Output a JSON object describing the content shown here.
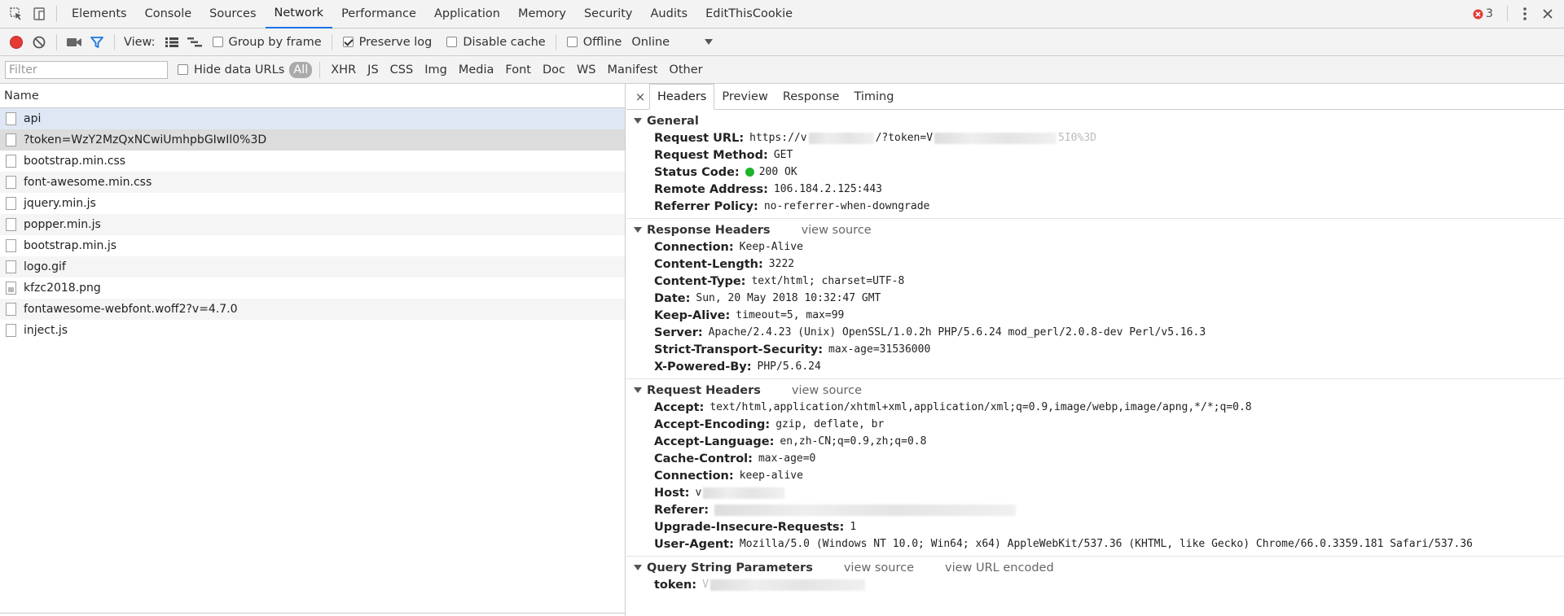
{
  "top": {
    "tabs": [
      "Elements",
      "Console",
      "Sources",
      "Network",
      "Performance",
      "Application",
      "Memory",
      "Security",
      "Audits",
      "EditThisCookie"
    ],
    "active_tab": "Network",
    "error_count": "3",
    "colors": {
      "error": "#e53935",
      "accent": "#1a73e8"
    }
  },
  "toolbar": {
    "view_label": "View:",
    "group_by_frame": "Group by frame",
    "preserve_log": "Preserve log",
    "disable_cache": "Disable cache",
    "offline": "Offline",
    "throttle": "Online",
    "record_color": "#e53935",
    "filter_icon_color": "#1a73e8"
  },
  "filterbar": {
    "filter_placeholder": "Filter",
    "hide_data_urls": "Hide data URLs",
    "types": [
      "All",
      "XHR",
      "JS",
      "CSS",
      "Img",
      "Media",
      "Font",
      "Doc",
      "WS",
      "Manifest",
      "Other"
    ],
    "selected_type": "All"
  },
  "requests": {
    "header": "Name",
    "items": [
      {
        "name": "api",
        "icon": "doc"
      },
      {
        "name": "?token=WzY2MzQxNCwiUmhpbGIwIl0%3D",
        "icon": "doc"
      },
      {
        "name": "bootstrap.min.css",
        "icon": "doc"
      },
      {
        "name": "font-awesome.min.css",
        "icon": "doc"
      },
      {
        "name": "jquery.min.js",
        "icon": "doc"
      },
      {
        "name": "popper.min.js",
        "icon": "doc"
      },
      {
        "name": "bootstrap.min.js",
        "icon": "doc"
      },
      {
        "name": "logo.gif",
        "icon": "doc"
      },
      {
        "name": "kfzc2018.png",
        "icon": "img"
      },
      {
        "name": "fontawesome-webfont.woff2?v=4.7.0",
        "icon": "doc"
      },
      {
        "name": "inject.js",
        "icon": "doc"
      }
    ]
  },
  "details": {
    "close": "×",
    "tabs": [
      "Headers",
      "Preview",
      "Response",
      "Timing"
    ],
    "active_tab": "Headers",
    "general": {
      "title": "General",
      "request_url_key": "Request URL:",
      "request_url_prefix": "https://v",
      "request_url_mid": "/?token=V",
      "request_url_tail": "5I0%3D",
      "method_key": "Request Method:",
      "method": "GET",
      "status_key": "Status Code:",
      "status": "200 OK",
      "remote_key": "Remote Address:",
      "remote": "106.184.2.125:443",
      "referrer_policy_key": "Referrer Policy:",
      "referrer_policy": "no-referrer-when-downgrade"
    },
    "response_headers": {
      "title": "Response Headers",
      "view_source": "view source",
      "items": [
        {
          "k": "Connection:",
          "v": "Keep-Alive"
        },
        {
          "k": "Content-Length:",
          "v": "3222"
        },
        {
          "k": "Content-Type:",
          "v": "text/html; charset=UTF-8"
        },
        {
          "k": "Date:",
          "v": "Sun, 20 May 2018 10:32:47 GMT"
        },
        {
          "k": "Keep-Alive:",
          "v": "timeout=5, max=99"
        },
        {
          "k": "Server:",
          "v": "Apache/2.4.23 (Unix) OpenSSL/1.0.2h PHP/5.6.24 mod_perl/2.0.8-dev Perl/v5.16.3"
        },
        {
          "k": "Strict-Transport-Security:",
          "v": "max-age=31536000"
        },
        {
          "k": "X-Powered-By:",
          "v": "PHP/5.6.24"
        }
      ]
    },
    "request_headers": {
      "title": "Request Headers",
      "view_source": "view source",
      "items": [
        {
          "k": "Accept:",
          "v": "text/html,application/xhtml+xml,application/xml;q=0.9,image/webp,image/apng,*/*;q=0.8"
        },
        {
          "k": "Accept-Encoding:",
          "v": "gzip, deflate, br"
        },
        {
          "k": "Accept-Language:",
          "v": "en,zh-CN;q=0.9,zh;q=0.8"
        },
        {
          "k": "Cache-Control:",
          "v": "max-age=0"
        },
        {
          "k": "Connection:",
          "v": "keep-alive"
        },
        {
          "k": "Host:",
          "v": "v"
        },
        {
          "k": "Referer:",
          "v": ""
        },
        {
          "k": "Upgrade-Insecure-Requests:",
          "v": "1"
        },
        {
          "k": "User-Agent:",
          "v": "Mozilla/5.0 (Windows NT 10.0; Win64; x64) AppleWebKit/537.36 (KHTML, like Gecko) Chrome/66.0.3359.181 Safari/537.36"
        }
      ]
    },
    "query_string": {
      "title": "Query String Parameters",
      "view_source": "view source",
      "view_url_encoded": "view URL encoded",
      "token_key": "token:",
      "token_value": "V"
    }
  }
}
